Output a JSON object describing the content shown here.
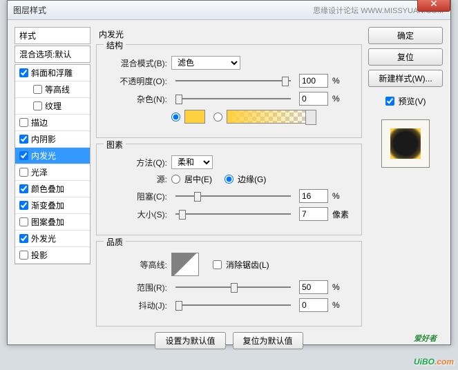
{
  "titlebar": {
    "title": "图层样式",
    "brand": "思缘设计论坛  WWW.MISSYUAN.COM"
  },
  "left": {
    "styles_header": "样式",
    "blend_header": "混合选项:默认",
    "items": [
      {
        "label": "斜面和浮雕",
        "chk": true,
        "indent": false
      },
      {
        "label": "等高线",
        "chk": false,
        "indent": true
      },
      {
        "label": "纹理",
        "chk": false,
        "indent": true
      },
      {
        "label": "描边",
        "chk": false,
        "indent": false
      },
      {
        "label": "内阴影",
        "chk": true,
        "indent": false
      },
      {
        "label": "内发光",
        "chk": true,
        "indent": false,
        "selected": true
      },
      {
        "label": "光泽",
        "chk": false,
        "indent": false
      },
      {
        "label": "颜色叠加",
        "chk": true,
        "indent": false
      },
      {
        "label": "渐变叠加",
        "chk": true,
        "indent": false
      },
      {
        "label": "图案叠加",
        "chk": false,
        "indent": false
      },
      {
        "label": "外发光",
        "chk": true,
        "indent": false
      },
      {
        "label": "投影",
        "chk": false,
        "indent": false
      }
    ]
  },
  "center": {
    "title": "内发光",
    "structure": {
      "legend": "结构",
      "blend_mode_label": "混合模式(B):",
      "blend_mode_value": "滤色",
      "opacity_label": "不透明度(O):",
      "opacity_value": "100",
      "opacity_unit": "%",
      "noise_label": "杂色(N):",
      "noise_value": "0",
      "noise_unit": "%",
      "color_swatch": "#ffd040"
    },
    "element": {
      "legend": "图素",
      "method_label": "方法(Q):",
      "method_value": "柔和",
      "source_label": "源:",
      "source_center": "居中(E)",
      "source_edge": "边缘(G)",
      "choke_label": "阻塞(C):",
      "choke_value": "16",
      "choke_unit": "%",
      "size_label": "大小(S):",
      "size_value": "7",
      "size_unit": "像素"
    },
    "quality": {
      "legend": "品质",
      "contour_label": "等高线:",
      "antialias_label": "消除锯齿(L)",
      "range_label": "范围(R):",
      "range_value": "50",
      "range_unit": "%",
      "jitter_label": "抖动(J):",
      "jitter_value": "0",
      "jitter_unit": "%"
    },
    "buttons": {
      "make_default": "设置为默认值",
      "reset_default": "复位为默认值"
    }
  },
  "right": {
    "ok": "确定",
    "reset": "复位",
    "new_style": "新建样式(W)...",
    "preview_label": "预览(V)"
  },
  "footer": {
    "logo1": "UiBO",
    "logo2": ".com",
    "tag": "爱好者"
  }
}
